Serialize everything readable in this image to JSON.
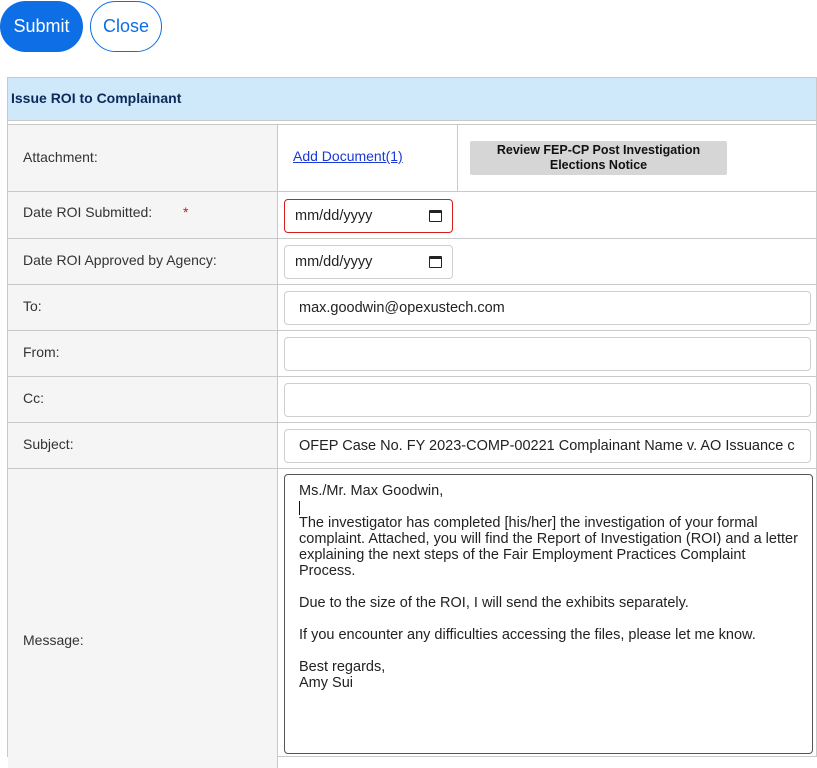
{
  "toolbar": {
    "submit_label": "Submit",
    "close_label": "Close"
  },
  "panel": {
    "title": "Issue ROI to Complainant"
  },
  "form": {
    "attachment": {
      "label": "Attachment:",
      "link": "Add Document(1)",
      "review_button": "Review FEP-CP Post Investigation Elections Notice"
    },
    "date_submitted": {
      "label": "Date ROI Submitted:",
      "required_mark": "*",
      "value": "mm/dd/yyyy"
    },
    "date_approved": {
      "label": "Date ROI Approved by Agency:",
      "value": "mm/dd/yyyy"
    },
    "to": {
      "label": "To:",
      "value": "max.goodwin@opexustech.com"
    },
    "from": {
      "label": "From:",
      "value": ""
    },
    "cc": {
      "label": "Cc:",
      "value": ""
    },
    "subject": {
      "label": "Subject:",
      "value": "OFEP Case No. FY 2023-COMP-00221 Complainant Name v. AO Issuance c"
    },
    "message": {
      "label": "Message:",
      "greeting": "Ms./Mr. Max Goodwin,",
      "para1": "The investigator has completed [his/her] the investigation of your formal complaint. Attached, you will find the Report of Investigation (ROI) and a letter explaining the next steps of the Fair Employment Practices Complaint Process.",
      "para2": "Due to the size of the ROI, I will send the exhibits separately.",
      "para3": "If you encounter any difficulties accessing the files, please let me know.",
      "closing": "Best regards,",
      "signature": "Amy Sui"
    }
  },
  "colors": {
    "accent": "#0d6ee6",
    "header_bg": "#cfe9fb",
    "required": "#e01010"
  },
  "icons": {
    "calendar": "calendar-icon"
  }
}
